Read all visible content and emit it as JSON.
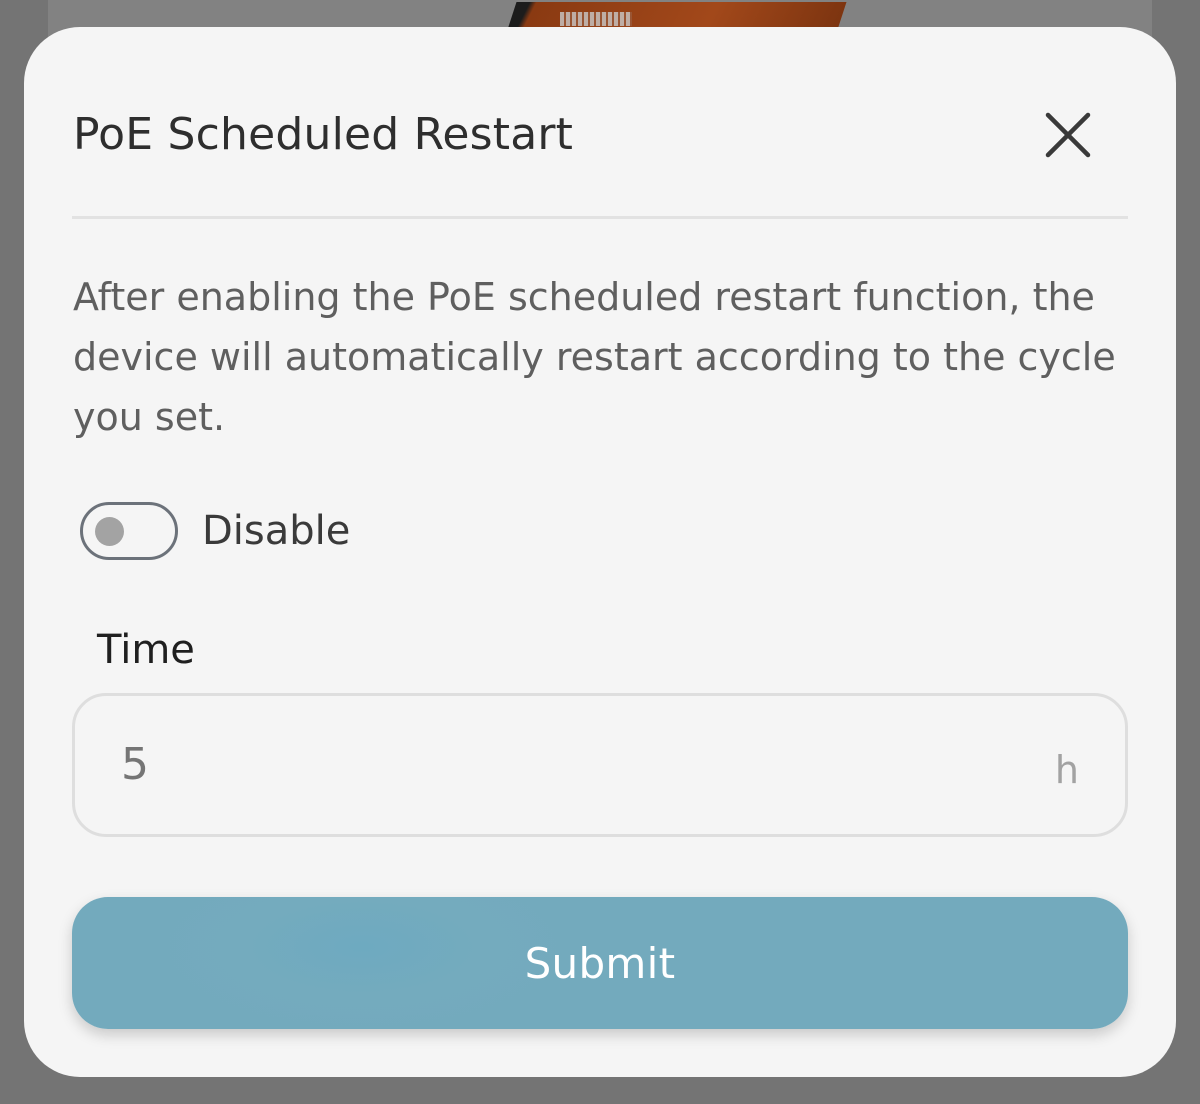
{
  "modal": {
    "title": "PoE Scheduled Restart",
    "description": "After enabling the PoE scheduled restart function, the device will automatically restart according to the cycle you set.",
    "toggle": {
      "label": "Disable",
      "enabled": false
    },
    "time": {
      "label": "Time",
      "placeholder": "5",
      "unit": "h"
    },
    "submit_label": "Submit"
  },
  "icons": {
    "close": "close-icon"
  },
  "colors": {
    "overlay": "#747474",
    "modal_background": "#f5f5f5",
    "primary_button": "#73aabd",
    "toggle_border": "#6c727a",
    "toggle_knob": "#a3a3a3"
  }
}
